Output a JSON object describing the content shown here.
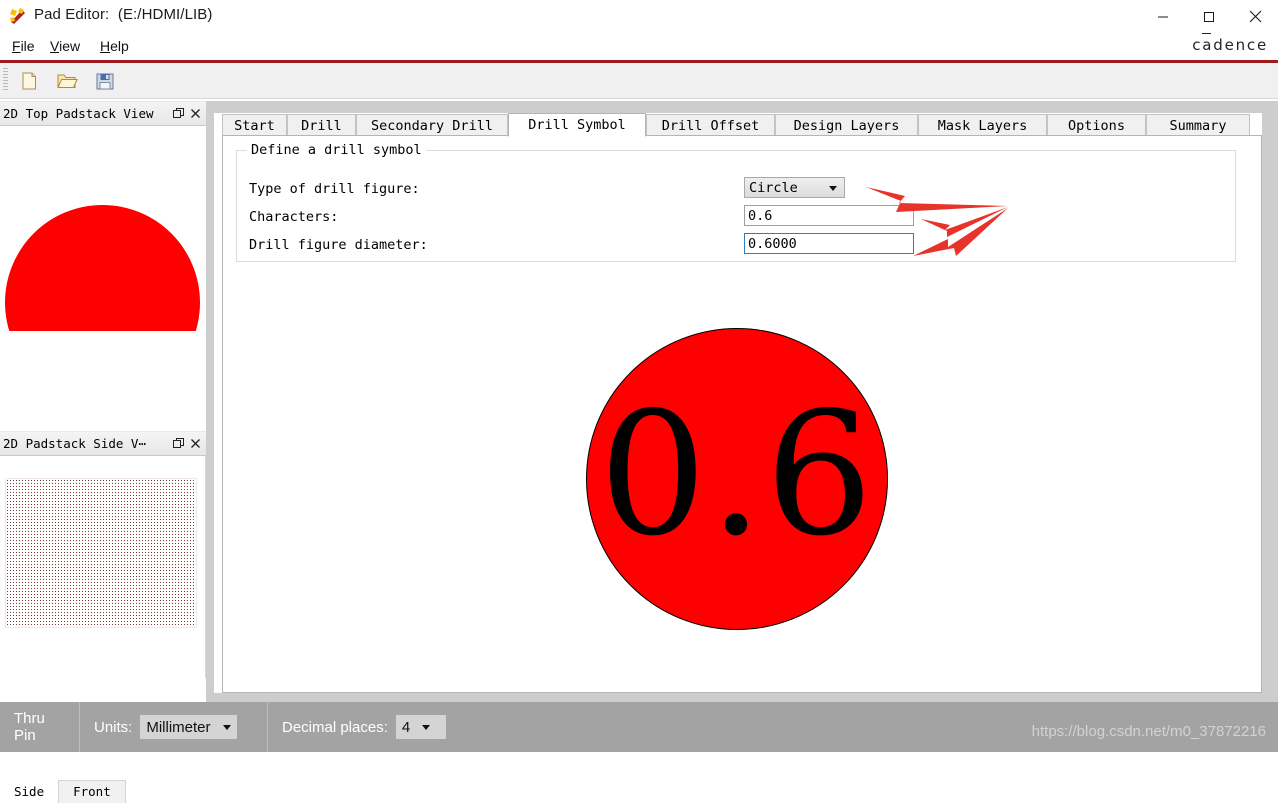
{
  "window": {
    "title": "Pad Editor:  (E:/HDMI/LIB)",
    "app_icon": "pad-editor-icon",
    "minimize": "—",
    "maximize": "□",
    "close": "✕"
  },
  "menubar": {
    "items": [
      {
        "first": "F",
        "rest": "ile"
      },
      {
        "first": "V",
        "rest": "iew"
      },
      {
        "first": "H",
        "rest": "elp"
      }
    ]
  },
  "brand": {
    "before": "c",
    "macron_letter": "a",
    "after": "dence"
  },
  "toolbar": {
    "buttons": [
      {
        "name": "new-file-icon",
        "tooltip": "New"
      },
      {
        "name": "open-file-icon",
        "tooltip": "Open"
      },
      {
        "name": "save-file-icon",
        "tooltip": "Save"
      }
    ]
  },
  "dock": {
    "top_panel": {
      "title": "2D Top Padstack View",
      "float_glyph": "❐",
      "close_glyph": "✕",
      "shape_color": "#ff0000"
    },
    "side_panel": {
      "title": "2D Padstack Side V⋯",
      "float_glyph": "❐",
      "close_glyph": "✕",
      "pattern_color": "#7a3a34"
    },
    "tabs": [
      {
        "label": "Side",
        "active": true
      },
      {
        "label": "Front",
        "active": false
      }
    ]
  },
  "tabs": [
    {
      "label": "Start",
      "active": false
    },
    {
      "label": "Drill",
      "active": false
    },
    {
      "label": "Secondary Drill",
      "active": false
    },
    {
      "label": "Drill Symbol",
      "active": true
    },
    {
      "label": "Drill Offset",
      "active": false
    },
    {
      "label": "Design Layers",
      "active": false
    },
    {
      "label": "Mask Layers",
      "active": false
    },
    {
      "label": "Options",
      "active": false
    },
    {
      "label": "Summary",
      "active": false
    }
  ],
  "form": {
    "group_title": "Define a drill symbol",
    "fields": {
      "type_label": "Type of drill figure:",
      "type_value": "Circle",
      "characters_label": "Characters:",
      "characters_value": "0.6",
      "diameter_label": "Drill figure diameter:",
      "diameter_value": "0.6000"
    }
  },
  "preview": {
    "symbol_text": "0.6",
    "fill_color": "#ff0000",
    "outline_color": "#000000"
  },
  "annotations": {
    "arrow_color": "#e8332a",
    "count": 3
  },
  "statusbar": {
    "pin_type": "Thru Pin",
    "units_label": "Units:",
    "units_value": "Millimeter",
    "decimal_label": "Decimal places:",
    "decimal_value": "4",
    "watermark": "https://blog.csdn.net/m0_37872216"
  }
}
